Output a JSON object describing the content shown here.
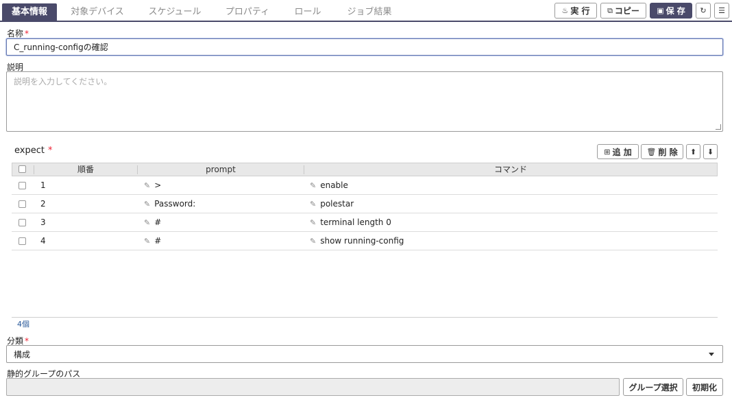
{
  "tabs": [
    {
      "label": "基本情報",
      "active": true
    },
    {
      "label": "対象デバイス"
    },
    {
      "label": "スケジュール"
    },
    {
      "label": "プロパティ"
    },
    {
      "label": "ロール"
    },
    {
      "label": "ジョブ結果"
    }
  ],
  "toolbar": {
    "run_label": "実 行",
    "copy_label": "コピー",
    "save_label": "保 存"
  },
  "form": {
    "name_label": "名称",
    "name_value": "C_running-configの確認",
    "description_label": "説明",
    "description_placeholder": "説明を入力してください。",
    "expect_label": "expect",
    "required_mark": "*",
    "add_label": "追 加",
    "delete_label": "削 除",
    "category_label": "分類",
    "category_value": "構成",
    "static_group_path_label": "静的グループのパス",
    "group_select_label": "グループ選択",
    "reset_label": "初期化"
  },
  "table": {
    "columns": [
      "順番",
      "prompt",
      "コマンド"
    ],
    "rows": [
      {
        "order": "1",
        "prompt": ">",
        "command": "enable"
      },
      {
        "order": "2",
        "prompt": "Password:",
        "command": "polestar"
      },
      {
        "order": "3",
        "prompt": "#",
        "command": "terminal length 0"
      },
      {
        "order": "4",
        "prompt": "#",
        "command": "show running-config"
      }
    ],
    "count_label": "4個"
  },
  "colors": {
    "accent": "#4a4a6a",
    "required": "#e23333",
    "link": "#2a5a9a"
  }
}
